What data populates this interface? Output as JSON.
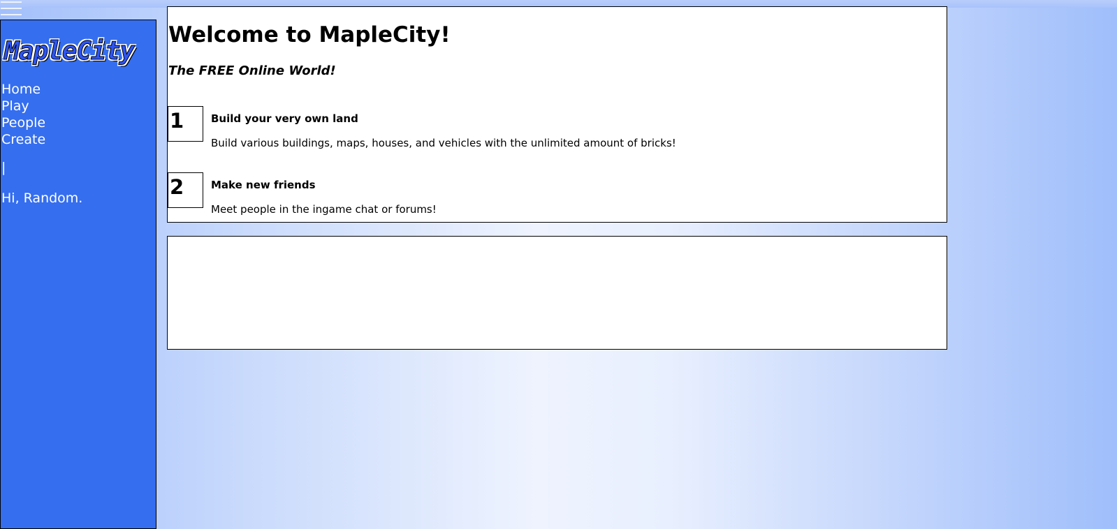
{
  "menu_icon": "hamburger-icon",
  "logo_text": "MapleCity",
  "nav": {
    "home": "Home",
    "play": "Play",
    "people": "People",
    "create": "Create"
  },
  "separator": "|",
  "greeting": "Hi, Random.",
  "welcome": {
    "title": "Welcome to MapleCity!",
    "tagline": "The FREE Online World!",
    "steps": [
      {
        "number": "1",
        "title": "Build your very own land",
        "description": "Build various buildings, maps, houses, and vehicles with the unlimited amount of bricks!"
      },
      {
        "number": "2",
        "title": "Make new friends",
        "description": "Meet people in the ingame chat or forums!"
      }
    ]
  },
  "colors": {
    "sidebar": "#356eee",
    "panel": "#ffffff",
    "background_edge": "#a3c0fb",
    "background_center": "#eef3fe"
  }
}
